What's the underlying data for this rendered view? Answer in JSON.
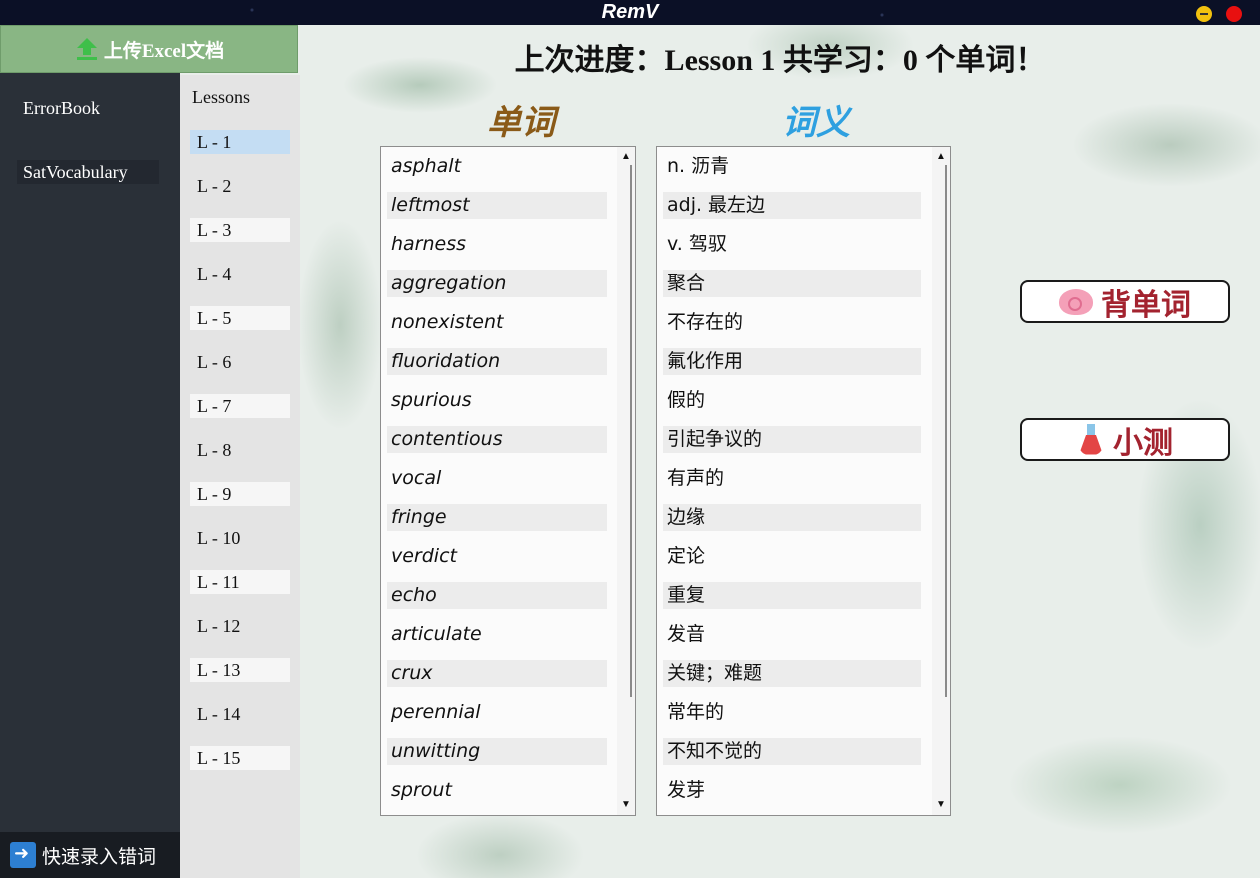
{
  "window": {
    "title": "RemV"
  },
  "sidebar": {
    "upload_label": "上传Excel文档",
    "items": [
      {
        "label": "ErrorBook"
      },
      {
        "label": "SatVocabulary"
      }
    ],
    "quick_entry_label": "快速录入错词"
  },
  "lessons": {
    "header": "Lessons",
    "items": [
      "L - 1",
      "L - 2",
      "L - 3",
      "L - 4",
      "L - 5",
      "L - 6",
      "L - 7",
      "L - 8",
      "L - 9",
      "L - 10",
      "L - 11",
      "L - 12",
      "L - 13",
      "L - 14",
      "L - 15"
    ],
    "selected": "L - 1"
  },
  "main": {
    "progress_title": "上次进度：Lesson 1  共学习：0 个单词！",
    "word_header": "单词",
    "meaning_header": "词义",
    "words": [
      "asphalt",
      "leftmost",
      "harness",
      "aggregation",
      "nonexistent",
      "fluoridation",
      "spurious",
      "contentious",
      "vocal",
      "fringe",
      "verdict",
      "echo",
      "articulate",
      "crux",
      "perennial",
      "unwitting",
      "sprout"
    ],
    "meanings": [
      "n.  沥青",
      "adj.  最左边",
      "v.  驾驭",
      "聚合",
      "不存在的",
      "氟化作用",
      "假的",
      "引起争议的",
      "有声的",
      "边缘",
      "定论",
      "重复",
      "发音",
      "关键；难题",
      "常年的",
      "不知不觉的",
      "发芽"
    ],
    "recite_button": "背单词",
    "quiz_button": "小测"
  },
  "colors": {
    "accent_button_text": "#a3232f",
    "word_header": "#8a5a18",
    "meaning_header": "#2ea0e0",
    "upload_bg": "#89b684"
  }
}
